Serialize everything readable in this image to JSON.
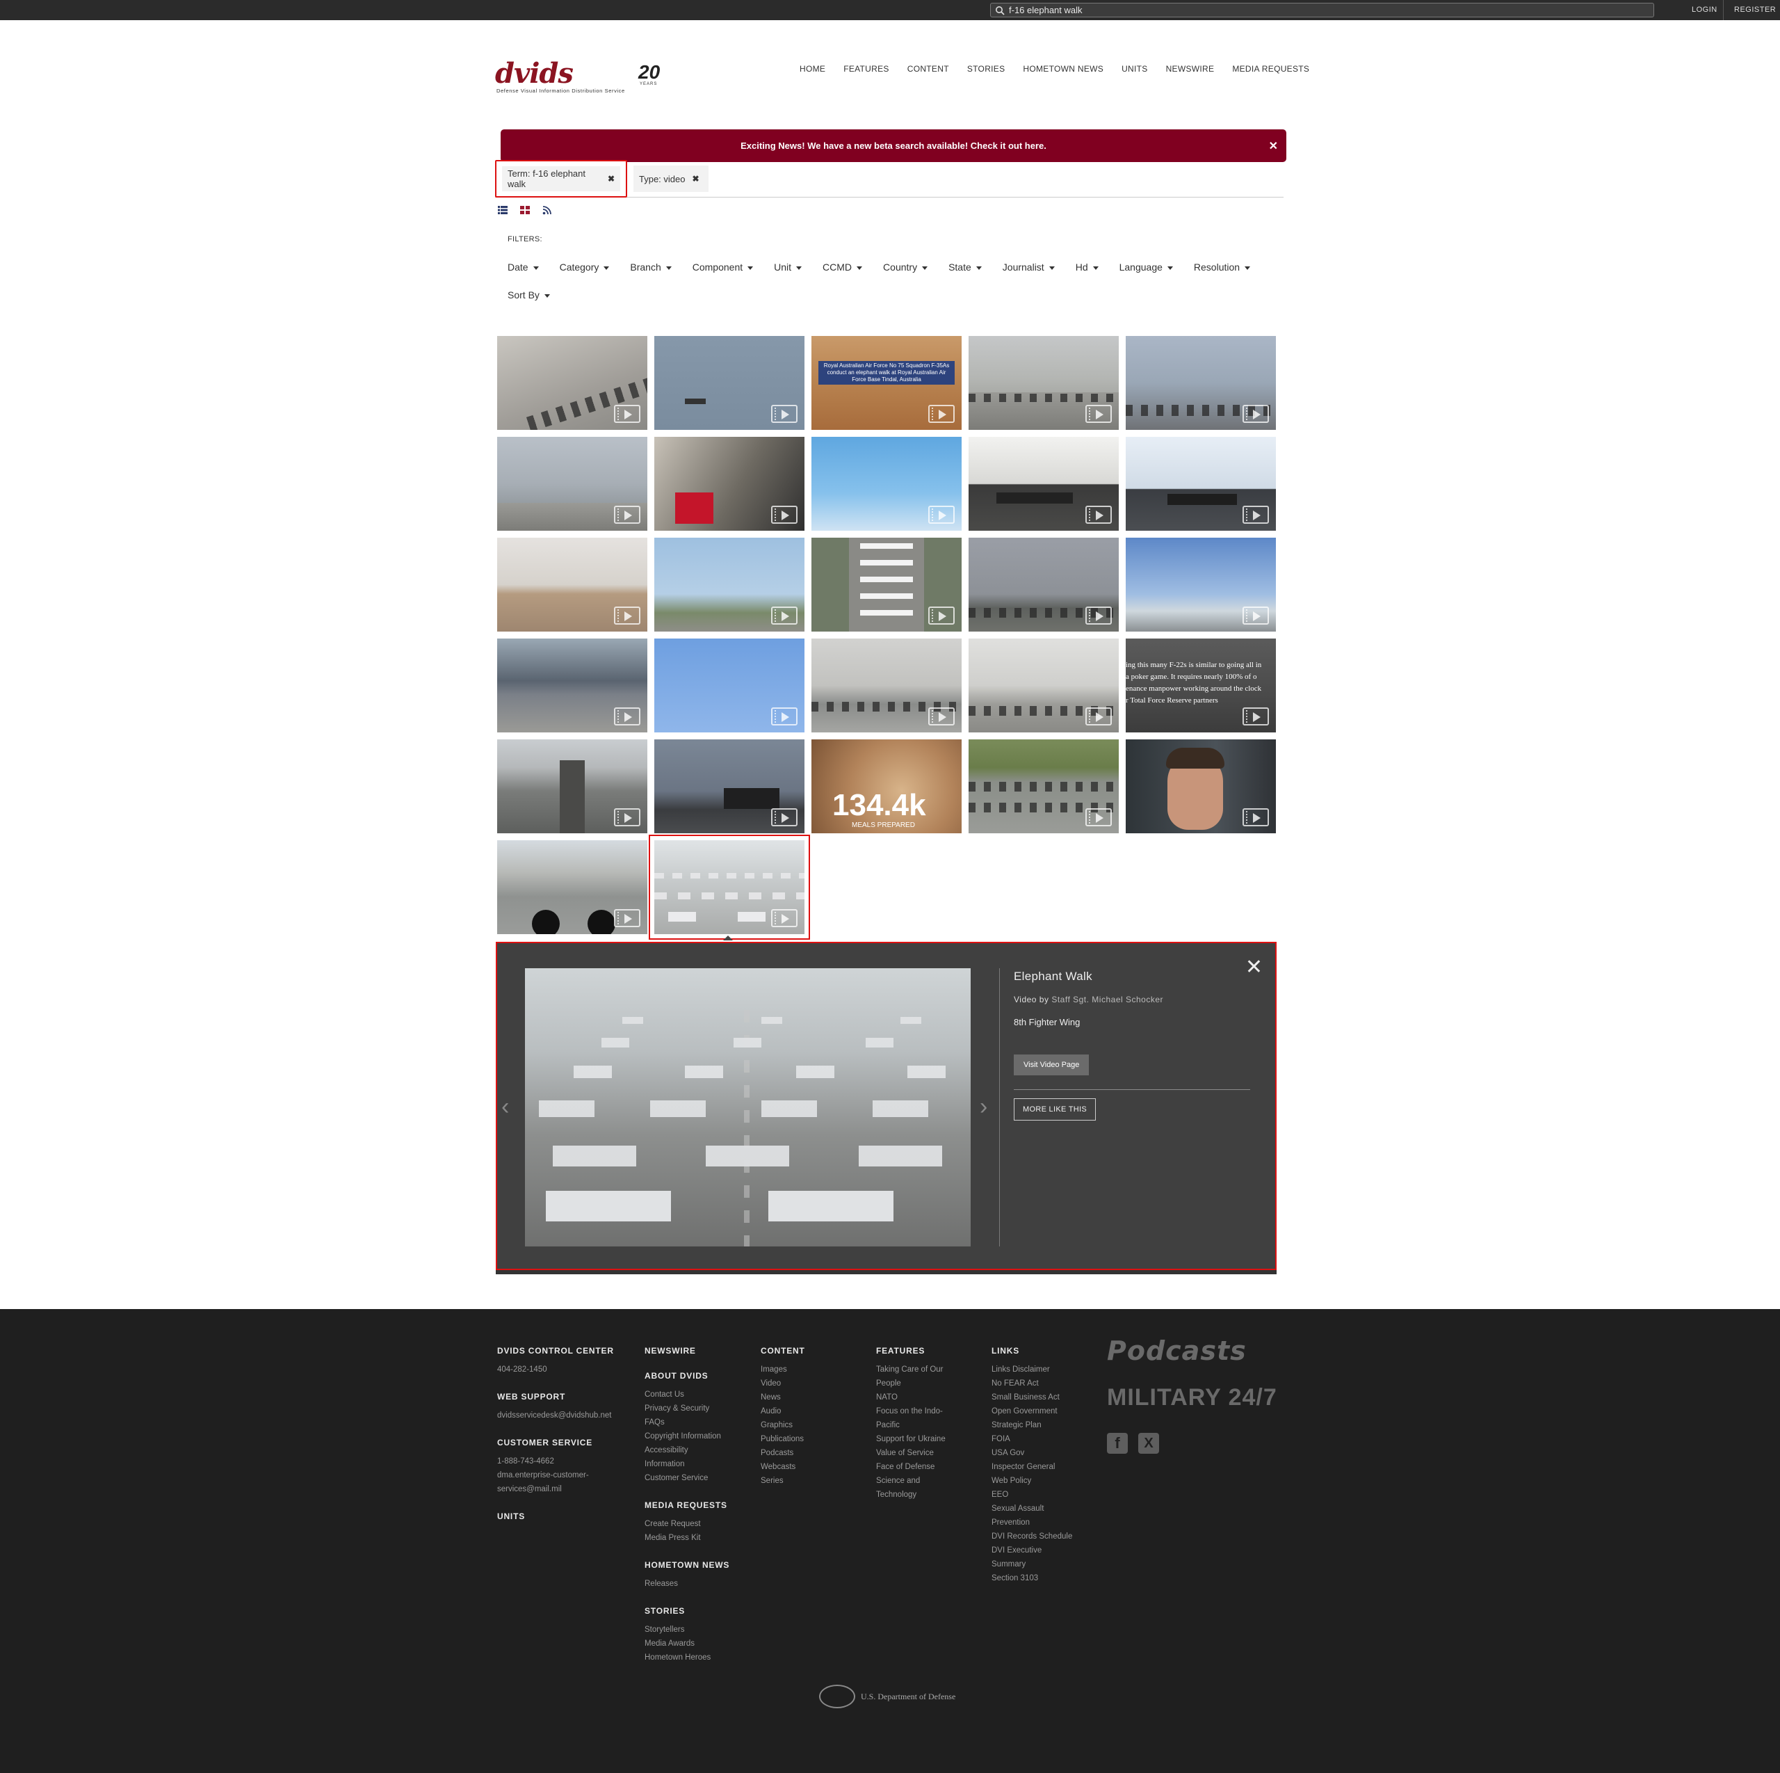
{
  "topbar": {
    "search_value": "f-16 elephant walk",
    "login": "LOGIN",
    "register": "REGISTER"
  },
  "header": {
    "logo_word": "dvids",
    "logo_subtitle": "Defense Visual Information Distribution Service",
    "logo_anniversary": "20",
    "logo_anniversary_sub": "YEARS",
    "nav": [
      "HOME",
      "FEATURES",
      "CONTENT",
      "STORIES",
      "HOMETOWN NEWS",
      "UNITS",
      "NEWSWIRE",
      "MEDIA REQUESTS"
    ]
  },
  "banner": {
    "text": "Exciting News! We have a new beta search available! Check it out here.",
    "accent": "#800020"
  },
  "chips": {
    "term": "Term: f-16 elephant walk",
    "type": "Type: video"
  },
  "filters": {
    "label": "FILTERS:",
    "items": [
      "Date",
      "Category",
      "Branch",
      "Component",
      "Unit",
      "CCMD",
      "Country",
      "State",
      "Journalist",
      "Hd",
      "Language",
      "Resolution"
    ],
    "sort_by": "Sort By"
  },
  "thumbnails": {
    "t3_overlay": "Royal Australian Air Force No 75 Squadron F-35As conduct an elephant walk at Royal Australian Air Force Base Tindal, Australia",
    "t23_stat": "134.4k",
    "t23_stat_sub": "MEALS PREPARED",
    "t20_quote": [
      "ing this many F-22s is similar to going all in",
      "a poker game. It requires nearly 100% of o",
      "enance manpower working around the clock",
      "r Total Force Reserve partners"
    ]
  },
  "panel": {
    "title": "Elephant Walk",
    "byline_prefix": "Video by ",
    "author": "Staff Sgt. Michael Schocker",
    "unit": "8th Fighter Wing",
    "visit_button": "Visit Video Page",
    "more_button": "MORE LIKE THIS"
  },
  "footer": {
    "col1": {
      "h1": "DVIDS CONTROL CENTER",
      "phone": "404-282-1450",
      "h2": "WEB SUPPORT",
      "email": "dvidsservicedesk@dvidshub.net",
      "h3": "CUSTOMER SERVICE",
      "cs_phone": "1-888-743-4662",
      "cs_email1": "dma.enterprise-customer-",
      "cs_email2": "services@mail.mil",
      "h4": "UNITS"
    },
    "col2": {
      "h1": "NEWSWIRE",
      "h2": "ABOUT DVIDS",
      "about": [
        "Contact Us",
        "Privacy & Security",
        "FAQs",
        "Copyright Information",
        "Accessibility",
        "Information",
        "Customer Service"
      ],
      "h3": "MEDIA REQUESTS",
      "media": [
        "Create Request",
        "Media Press Kit"
      ],
      "h4": "HOMETOWN NEWS",
      "hometown": [
        "Releases"
      ],
      "h5": "STORIES",
      "stories": [
        "Storytellers",
        "Media Awards",
        "Hometown Heroes"
      ]
    },
    "col3": {
      "h1": "CONTENT",
      "links": [
        "Images",
        "Video",
        "News",
        "Audio",
        "Graphics",
        "Publications",
        "Podcasts",
        "Webcasts",
        "Series"
      ]
    },
    "col4": {
      "h1": "FEATURES",
      "links": [
        "Taking Care of Our",
        "People",
        "NATO",
        "Focus on the Indo-",
        "Pacific",
        "Support for Ukraine",
        "Value of Service",
        "Face of Defense",
        "Science and",
        "Technology"
      ]
    },
    "col5": {
      "h1": "LINKS",
      "links": [
        "Links Disclaimer",
        "No FEAR Act",
        "Small Business Act",
        "Open Government",
        "Strategic Plan",
        "FOIA",
        "USA Gov",
        "Inspector General",
        "Web Policy",
        "EEO",
        "Sexual Assault",
        "Prevention",
        "DVI Records Schedule",
        "DVI Executive",
        "Summary",
        "Section 3103"
      ]
    },
    "podcasts": "Podcasts",
    "military": "MILITARY 24/7",
    "facebook": "f",
    "x": "X",
    "dod": "U.S. Department of Defense"
  }
}
